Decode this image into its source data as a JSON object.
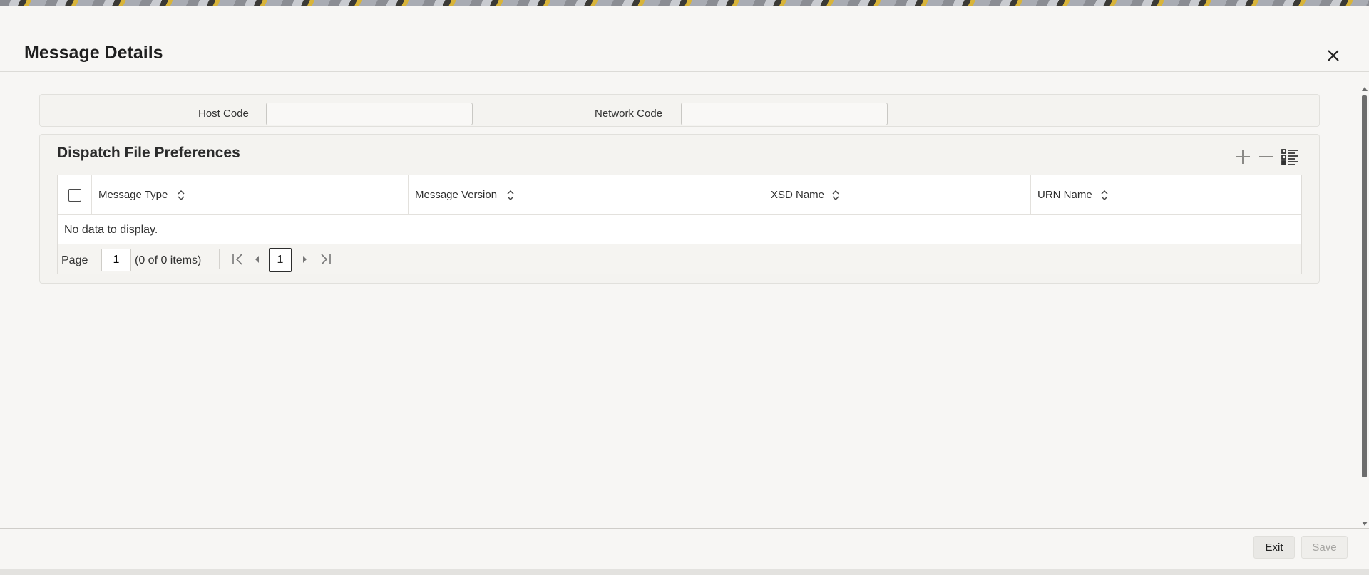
{
  "dialog": {
    "title": "Message Details",
    "close_icon": "close-icon"
  },
  "host_panel": {
    "host_code_label": "Host Code",
    "host_code_value": "",
    "network_code_label": "Network Code",
    "network_code_value": ""
  },
  "dispatch": {
    "title": "Dispatch File Preferences",
    "toolbar": {
      "add_icon": "plus-icon",
      "remove_icon": "minus-icon",
      "view_icon": "list-view-icon"
    },
    "columns": [
      {
        "label": "Message Type"
      },
      {
        "label": "Message Version"
      },
      {
        "label": "XSD Name"
      },
      {
        "label": "URN Name"
      }
    ],
    "empty_text": "No data to display.",
    "pager": {
      "label": "Page",
      "page_input": "1",
      "count_text": "(0 of 0 items)",
      "current_page": "1"
    }
  },
  "footer": {
    "exit_label": "Exit",
    "save_label": "Save"
  },
  "colors": {
    "background": "#f7f6f4",
    "panel": "#f4f3f0",
    "border": "#e1e0dc",
    "text": "#2a2a2a",
    "disabled_text": "#a5a4a1"
  }
}
